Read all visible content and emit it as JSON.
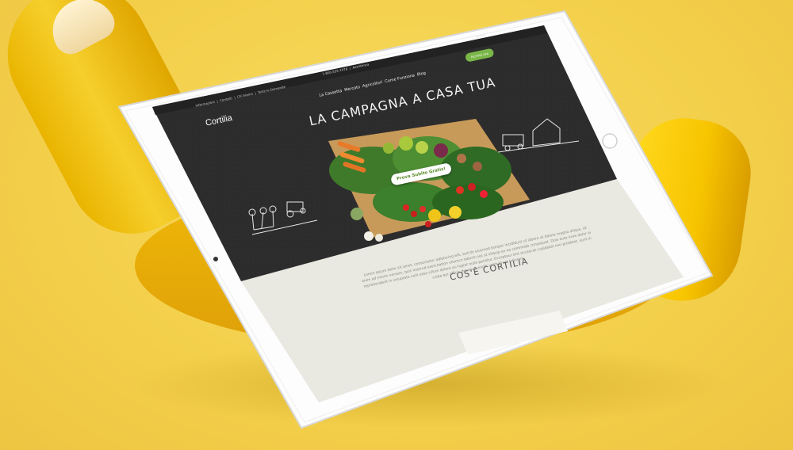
{
  "header": {
    "top_links": [
      "Informazioni",
      "Contatti",
      "Chi Siamo",
      "Tutte le Domande"
    ],
    "phone": "1-800-555-1478",
    "phone_secondary": "Assistenza",
    "login_label": "Entra",
    "register_label": "Iscriviti ora",
    "logo": "Cortilia",
    "menu": [
      "La Cassetta",
      "Mercato",
      "Agricoltori",
      "Come Funziona",
      "Blog"
    ]
  },
  "hero": {
    "title": "LA CAMPAGNA A CASA TUA",
    "cta_label": "Prova Subito Gratis!"
  },
  "about": {
    "title": "COS'È CORTILIA",
    "body": "Lorem ipsum dolor sit amet, consectetur adipiscing elit, sed do eiusmod tempor incididunt ut labore et dolore magna aliqua. Ut enim ad minim veniam, quis nostrud exercitation ullamco laboris nisi ut aliquip ex ea commodo consequat. Duis aute irure dolor in reprehenderit in voluptate velit esse cillum dolore eu fugiat nulla pariatur. Excepteur sint occaecat cupidatat non proident, sunt in culpa qui officia deserunt mollit anim id est laborum."
  },
  "colors": {
    "background": "#f5d450",
    "chalkboard": "#2b2b2b",
    "accent_green": "#7ab648",
    "lower_panel": "#e9e8e1"
  }
}
